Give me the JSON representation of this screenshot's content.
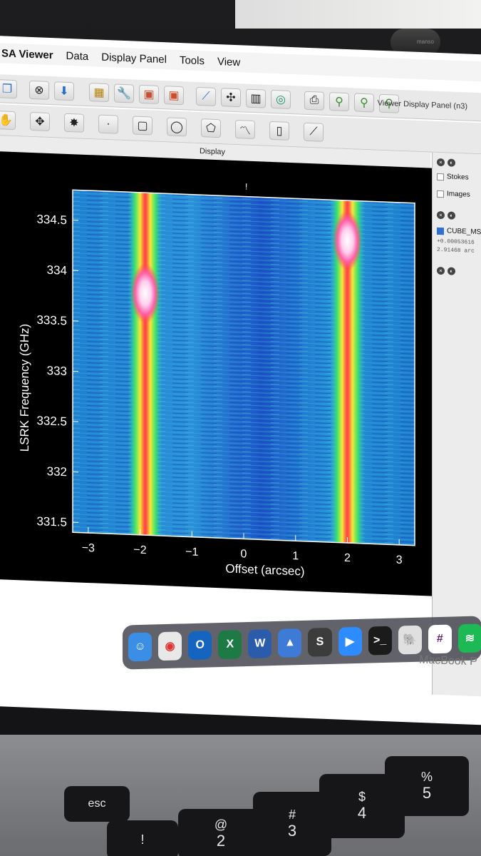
{
  "menubar": {
    "app": "SA Viewer",
    "items": [
      "Data",
      "Display Panel",
      "Tools",
      "View"
    ]
  },
  "toolbar": {
    "panel_title": "Viewer Display Panel (n3)"
  },
  "display_label": "Display",
  "side_panel": {
    "stokes": "Stokes",
    "images": "Images",
    "cube_name": "CUBE_MS",
    "value_line1": "+0.00053616",
    "value_line2": "2.91468 arc"
  },
  "camera_cover": "manso",
  "dock_apps": [
    "finder-icon",
    "chrome-icon",
    "outlook-icon",
    "excel-icon",
    "word-icon",
    "keynote-icon",
    "sublime-icon",
    "zoom-icon",
    "terminal-icon",
    "evernote-icon",
    "slack-icon",
    "spotify-icon"
  ],
  "brand": "MacBook P",
  "keys": {
    "esc": "esc",
    "one": "!",
    "two": "@\n2",
    "three": "#\n3",
    "four": "$\n4",
    "five": "%\n5"
  },
  "chart_data": {
    "type": "heatmap",
    "title": "",
    "xlabel": "Offset (arcsec)",
    "ylabel": "LSRK Frequency (GHz)",
    "x_ticks": [
      "−3",
      "−2",
      "−1",
      "0",
      "1",
      "2",
      "3"
    ],
    "y_ticks": [
      "334.5",
      "334",
      "333.5",
      "333",
      "332.5",
      "332",
      "331.5"
    ],
    "xlim": [
      -3.3,
      3.3
    ],
    "ylim": [
      331.4,
      334.8
    ],
    "colormap": "rainbow",
    "features": [
      {
        "x": -1.9,
        "peak_freq": 333.8
      },
      {
        "x": 2.0,
        "peak_freq": 334.4
      }
    ]
  }
}
